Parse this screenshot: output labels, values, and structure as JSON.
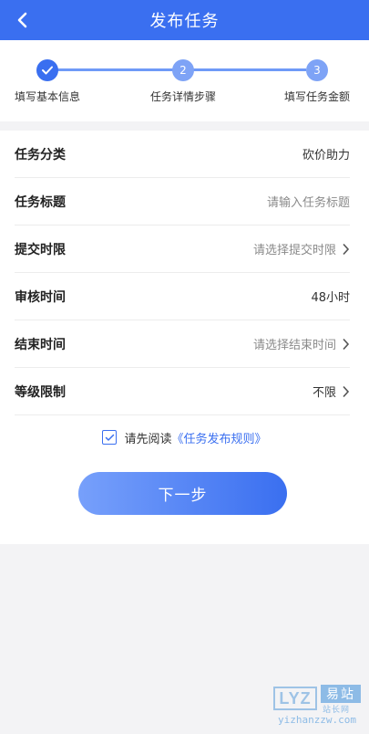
{
  "header": {
    "title": "发布任务",
    "background_color": "#3a6ff0"
  },
  "steps": [
    {
      "number": "",
      "label": "填写基本信息",
      "status": "done"
    },
    {
      "number": "2",
      "label": "任务详情步骤",
      "status": "pending"
    },
    {
      "number": "3",
      "label": "填写任务金额",
      "status": "pending"
    }
  ],
  "form": {
    "rows": [
      {
        "label": "任务分类",
        "value": "砍价助力",
        "kind": "value",
        "chevron": false
      },
      {
        "label": "任务标题",
        "placeholder": "请输入任务标题",
        "kind": "input",
        "chevron": false
      },
      {
        "label": "提交时限",
        "placeholder": "请选择提交时限",
        "kind": "select",
        "chevron": true
      },
      {
        "label": "审核时间",
        "value": "48小时",
        "kind": "value",
        "chevron": false
      },
      {
        "label": "结束时间",
        "placeholder": "请选择结束时间",
        "kind": "select",
        "chevron": true
      },
      {
        "label": "等级限制",
        "value": "不限",
        "kind": "select",
        "chevron": true
      }
    ]
  },
  "agreement": {
    "checked": true,
    "text": "请先阅读",
    "link_text": "《任务发布规则》"
  },
  "next_button": {
    "label": "下一步"
  },
  "watermark": {
    "logo_text": "LYZ",
    "name": "易站",
    "sub": "站长网",
    "url": "yizhanzzw.com"
  },
  "icons": {
    "back": "chevron-left-icon",
    "check": "check-icon",
    "row_chevron": "chevron-right-icon"
  },
  "colors": {
    "primary": "#3a6ff0",
    "step_pending": "#7ea3f6",
    "page_bg": "#f3f3f5"
  }
}
